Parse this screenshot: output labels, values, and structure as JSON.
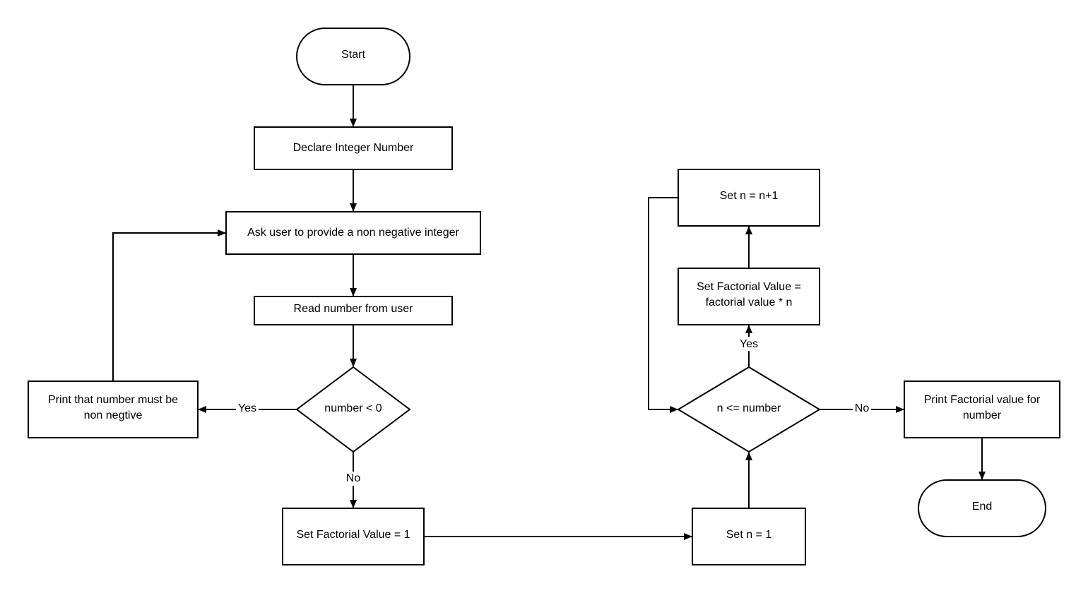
{
  "nodes": {
    "start": "Start",
    "declare": "Declare Integer Number",
    "ask": "Ask user to provide a non negative integer",
    "read": "Read number from user",
    "check_negative": "number < 0",
    "print_error": [
      "Print that number must be",
      "non negtive"
    ],
    "set_factorial": "Set Factorial Value = 1",
    "set_n": "Set n = 1",
    "loop_check": "n <= number",
    "multiply": [
      "Set Factorial Value =",
      "factorial value * n"
    ],
    "increment": "Set n = n+1",
    "print_result": [
      "Print Factorial value for",
      "number"
    ],
    "end": "End"
  },
  "edge_labels": {
    "negative_yes": "Yes",
    "negative_no": "No",
    "loop_yes": "Yes",
    "loop_no": "No"
  },
  "colors": {
    "stroke": "#000000",
    "fill": "#ffffff"
  }
}
